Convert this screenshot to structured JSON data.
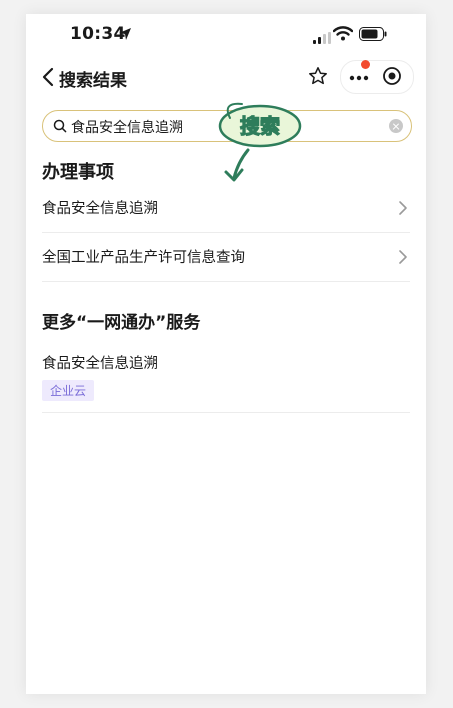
{
  "status_bar": {
    "time": "10:34"
  },
  "nav": {
    "title": "搜索结果",
    "unread_dot_color": "#f24a2e"
  },
  "search": {
    "value": "食品安全信息追溯"
  },
  "stamp": {
    "text": "搜索"
  },
  "section_items": {
    "heading": "办理事项",
    "items": [
      {
        "label": "食品安全信息追溯"
      },
      {
        "label": "全国工业产品生产许可信息查询"
      }
    ]
  },
  "section_services": {
    "heading": "更多“一网通办”服务",
    "items": [
      {
        "title": "食品安全信息追溯",
        "tag": "企业云"
      }
    ]
  },
  "colors": {
    "search_border": "#d9c27a",
    "tag_bg": "#eeeafd",
    "tag_text": "#7a6cd8",
    "stamp": "#2e7d5b"
  }
}
